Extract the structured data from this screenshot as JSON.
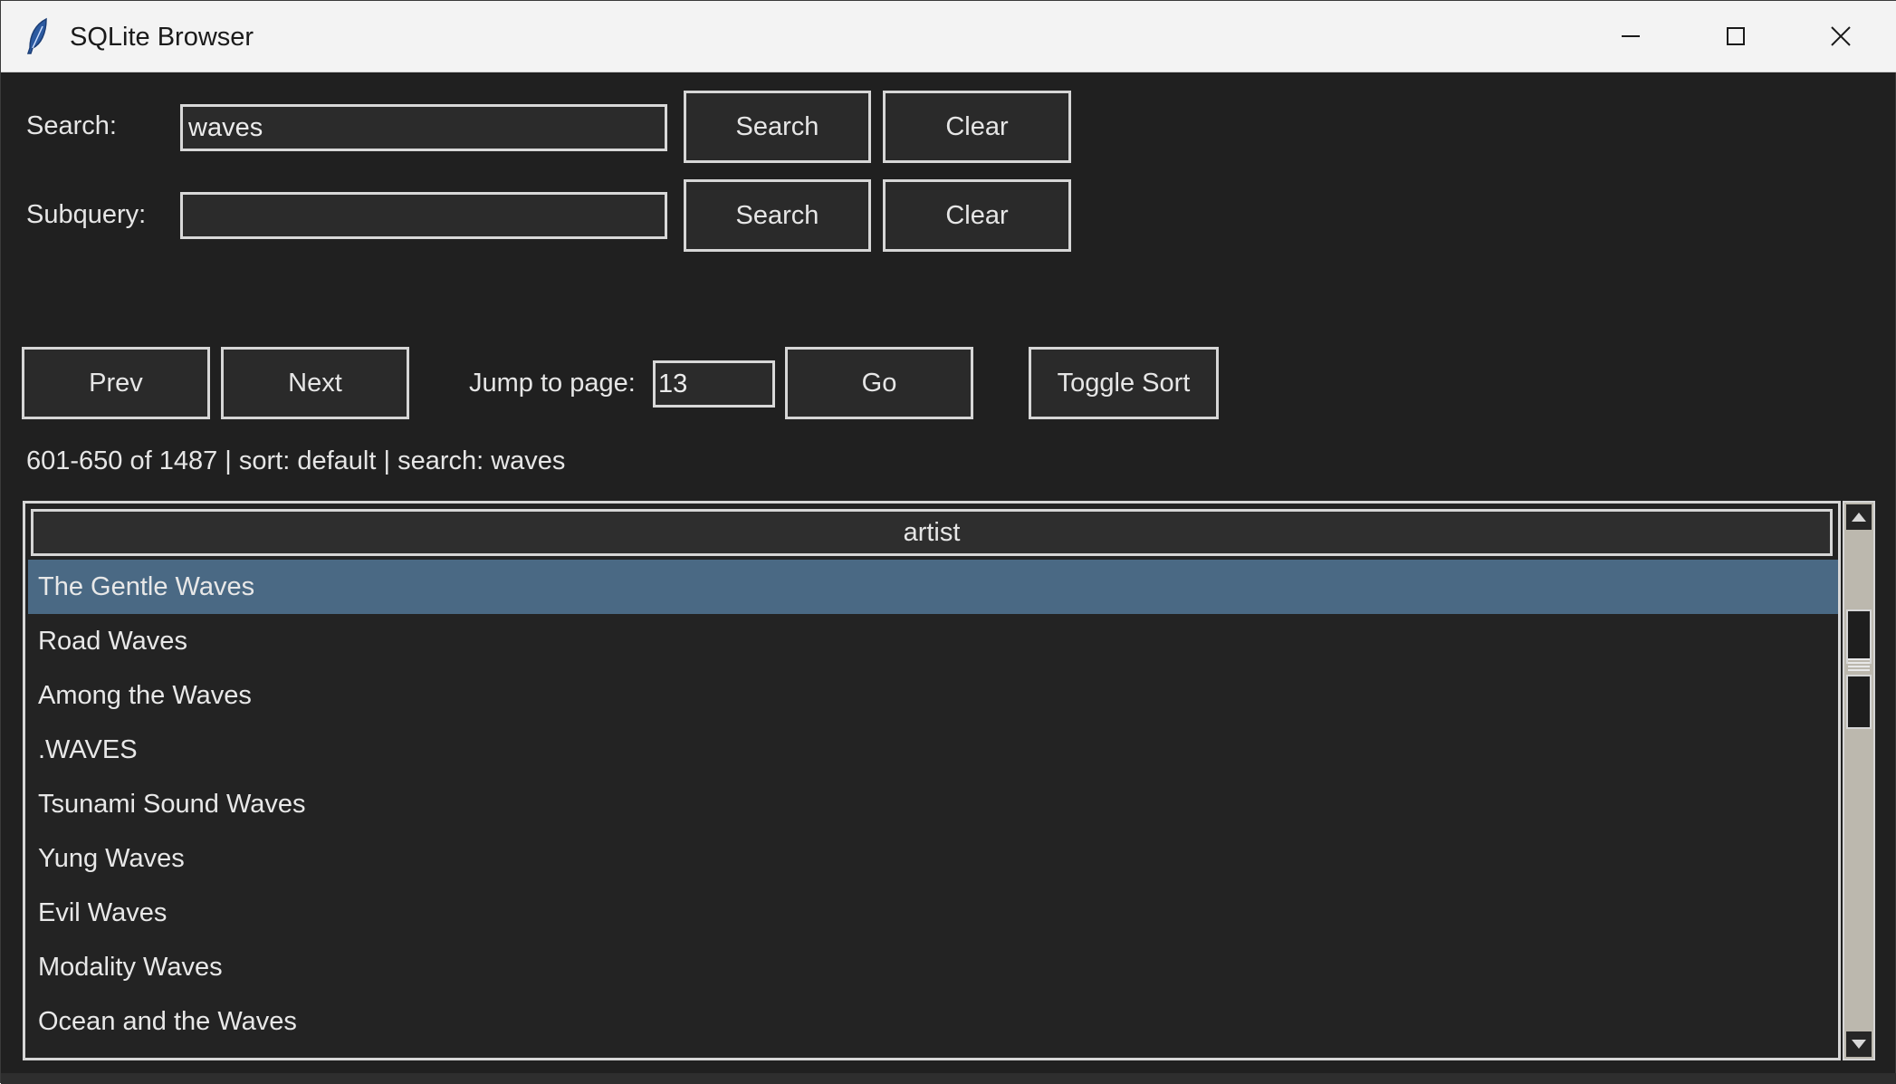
{
  "window": {
    "title": "SQLite Browser",
    "icon": "feather-icon",
    "controls": [
      "minimize-icon",
      "maximize-icon",
      "close-icon"
    ]
  },
  "search": {
    "label": "Search:",
    "value": "waves",
    "search_button": "Search",
    "clear_button": "Clear"
  },
  "subquery": {
    "label": "Subquery:",
    "value": "",
    "search_button": "Search",
    "clear_button": "Clear"
  },
  "pager": {
    "prev_button": "Prev",
    "next_button": "Next",
    "jump_label": "Jump to page:",
    "jump_value": "13",
    "go_button": "Go",
    "toggle_sort_button": "Toggle Sort"
  },
  "status": "601-650 of 1487 | sort: default | search: waves",
  "table": {
    "columns": [
      "artist"
    ],
    "selected_index": 0,
    "rows": [
      "The Gentle Waves",
      "Road Waves",
      "Among the Waves",
      ".WAVES",
      "Tsunami Sound Waves",
      "Yung Waves",
      "Evil Waves",
      "Modality Waves",
      "Ocean and the Waves"
    ]
  },
  "colors": {
    "background": "#202020",
    "selection": "#4a6984",
    "titlebar": "#f3f3f3"
  }
}
